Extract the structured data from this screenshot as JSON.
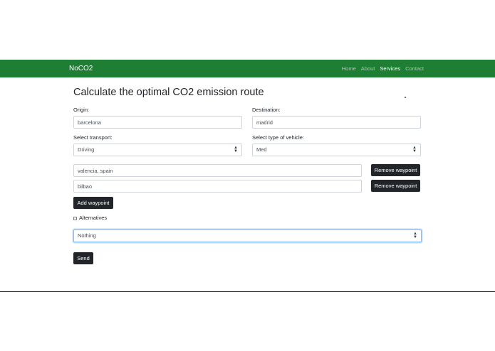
{
  "navbar": {
    "brand": "NoCO2",
    "links": [
      {
        "label": "Home",
        "active": false
      },
      {
        "label": "About",
        "active": false
      },
      {
        "label": "Services",
        "active": true
      },
      {
        "label": "Contact",
        "active": false
      }
    ],
    "color": "#1e7e34"
  },
  "form": {
    "title": "Calculate the optimal CO2 emission route",
    "origin": {
      "label": "Origin:",
      "value": "barcelona"
    },
    "destination": {
      "label": "Destination:",
      "value": "madrid"
    },
    "transport": {
      "label": "Select transport:",
      "value": "Driving"
    },
    "vehicle": {
      "label": "Select type of vehicle:",
      "value": "Med"
    },
    "waypoints": [
      {
        "value": "valencia, spain",
        "remove_label": "Remove waypoint"
      },
      {
        "value": "bilbao",
        "remove_label": "Remove waypoint"
      }
    ],
    "add_waypoint_label": "Add waypoint",
    "alternatives": {
      "label": "Alternatives",
      "checked": false
    },
    "extra_select": {
      "value": "Nothing"
    },
    "send_label": "Send"
  },
  "icons": {
    "select_caret": "select-caret-icon"
  }
}
